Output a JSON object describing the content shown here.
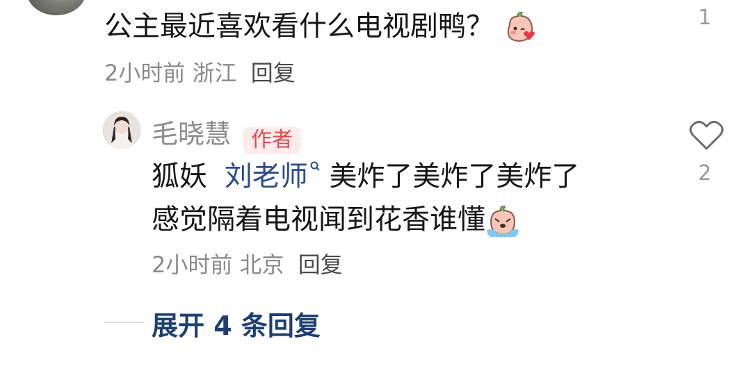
{
  "comment": {
    "text": "公主最近喜欢看什么电视剧鸭？",
    "emoji": "blush-kiss-emoji",
    "time": "2小时前",
    "location": "浙江",
    "reply_label": "回复",
    "like_count": "1"
  },
  "reply": {
    "username": "毛晓慧",
    "badge": "作者",
    "line1_prefix": "狐妖",
    "mention": "刘老师",
    "line1_suffix": "美炸了美炸了美炸了",
    "line2": "感觉隔着电视闻到花香谁懂",
    "emoji": "crying-emoji",
    "time": "2小时前",
    "location": "北京",
    "reply_label": "回复",
    "like_count": "2",
    "like_icon": "heart-outline-icon"
  },
  "expand": {
    "label": "展开 4 条回复"
  },
  "colors": {
    "mention": "#2a4b8d",
    "badge_bg": "#fdecec",
    "badge_text": "#e5484d",
    "expand_text": "#1e3f73"
  }
}
